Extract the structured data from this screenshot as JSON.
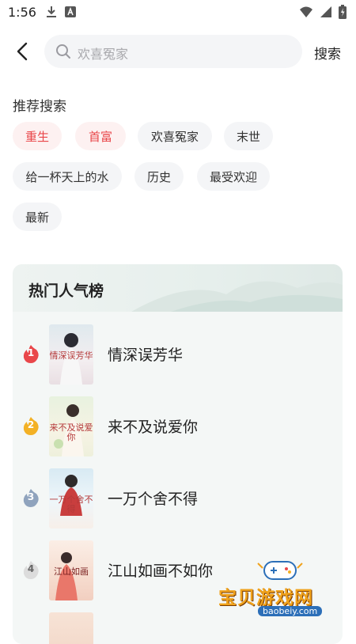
{
  "status_bar": {
    "time": "1:56"
  },
  "search": {
    "placeholder": "欢喜冤家",
    "button_label": "搜索"
  },
  "recommended": {
    "title": "推荐搜索",
    "tags": [
      "重生",
      "首富",
      "欢喜冤家",
      "末世",
      "给一杯天上的水",
      "历史",
      "最受欢迎",
      "最新"
    ]
  },
  "hot_list": {
    "title": "热门人气榜",
    "items": [
      {
        "rank": "1",
        "title": "情深误芳华",
        "cover_text": "情深误芳华",
        "badge_color": "#e9474a"
      },
      {
        "rank": "2",
        "title": "来不及说爱你",
        "cover_text": "来不及说爱你",
        "badge_color": "#f3b125"
      },
      {
        "rank": "3",
        "title": "一万个舍不得",
        "cover_text": "一万个舍不得",
        "badge_color": "#8fa3bd"
      },
      {
        "rank": "4",
        "title": "江山如画不如你",
        "cover_text": "江山如画",
        "badge_color": "#d6d6d6"
      }
    ]
  },
  "watermark": {
    "text": "宝贝游戏网",
    "url": "baobeiy.com"
  },
  "colors": {
    "accent": "#e9474a",
    "tag_bg": "#f4f5f7",
    "card_bg": "#f4f7f6"
  }
}
